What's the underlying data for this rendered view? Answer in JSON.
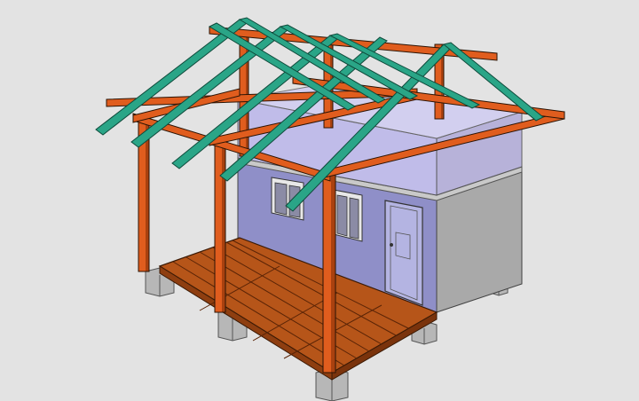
{
  "scene": {
    "subject": "",
    "colors": {
      "background": "#e3e3e3",
      "post": "#dc5a1c",
      "post_dark": "#a9410f",
      "rafter": "#2aa587",
      "rafter_dark": "#1c7a63",
      "deck": "#b8561a",
      "deck_dark": "#6e2f0b",
      "wall": "#8e8ec9",
      "wall_side": "#a8a8a8",
      "gable_glass": "#bfb9ea",
      "footing": "#b5b5b5",
      "door": "#b2b2e0",
      "window_glass": "#8a8aa6"
    }
  }
}
